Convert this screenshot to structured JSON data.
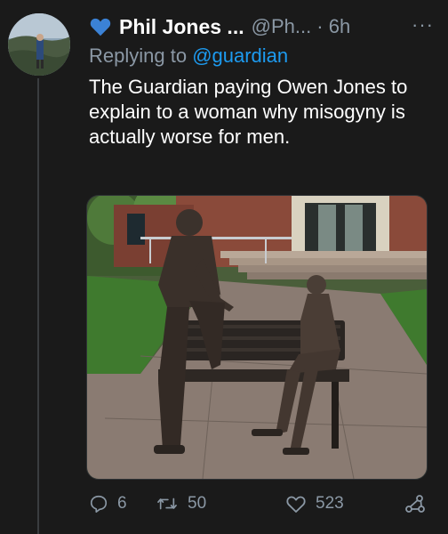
{
  "tweet": {
    "author_name": "Phil Jones ...",
    "author_handle": "@Ph... · 6h",
    "replying_prefix": "Replying to ",
    "replying_to": "@guardian",
    "text": "The Guardian paying Owen Jones to explain to a woman why misogyny is actually worse for men.",
    "more_label": "···"
  },
  "actions": {
    "replies": "6",
    "retweets": "50",
    "likes": "523"
  },
  "icons": {
    "verified_heart": "blue-heart-icon",
    "reply": "reply-icon",
    "retweet": "retweet-icon",
    "like": "like-icon",
    "share": "share-icon"
  },
  "colors": {
    "background": "#1a1a1a",
    "accent": "#1d9bf0",
    "muted": "#8b98a5",
    "heart": "#3b82d6"
  }
}
